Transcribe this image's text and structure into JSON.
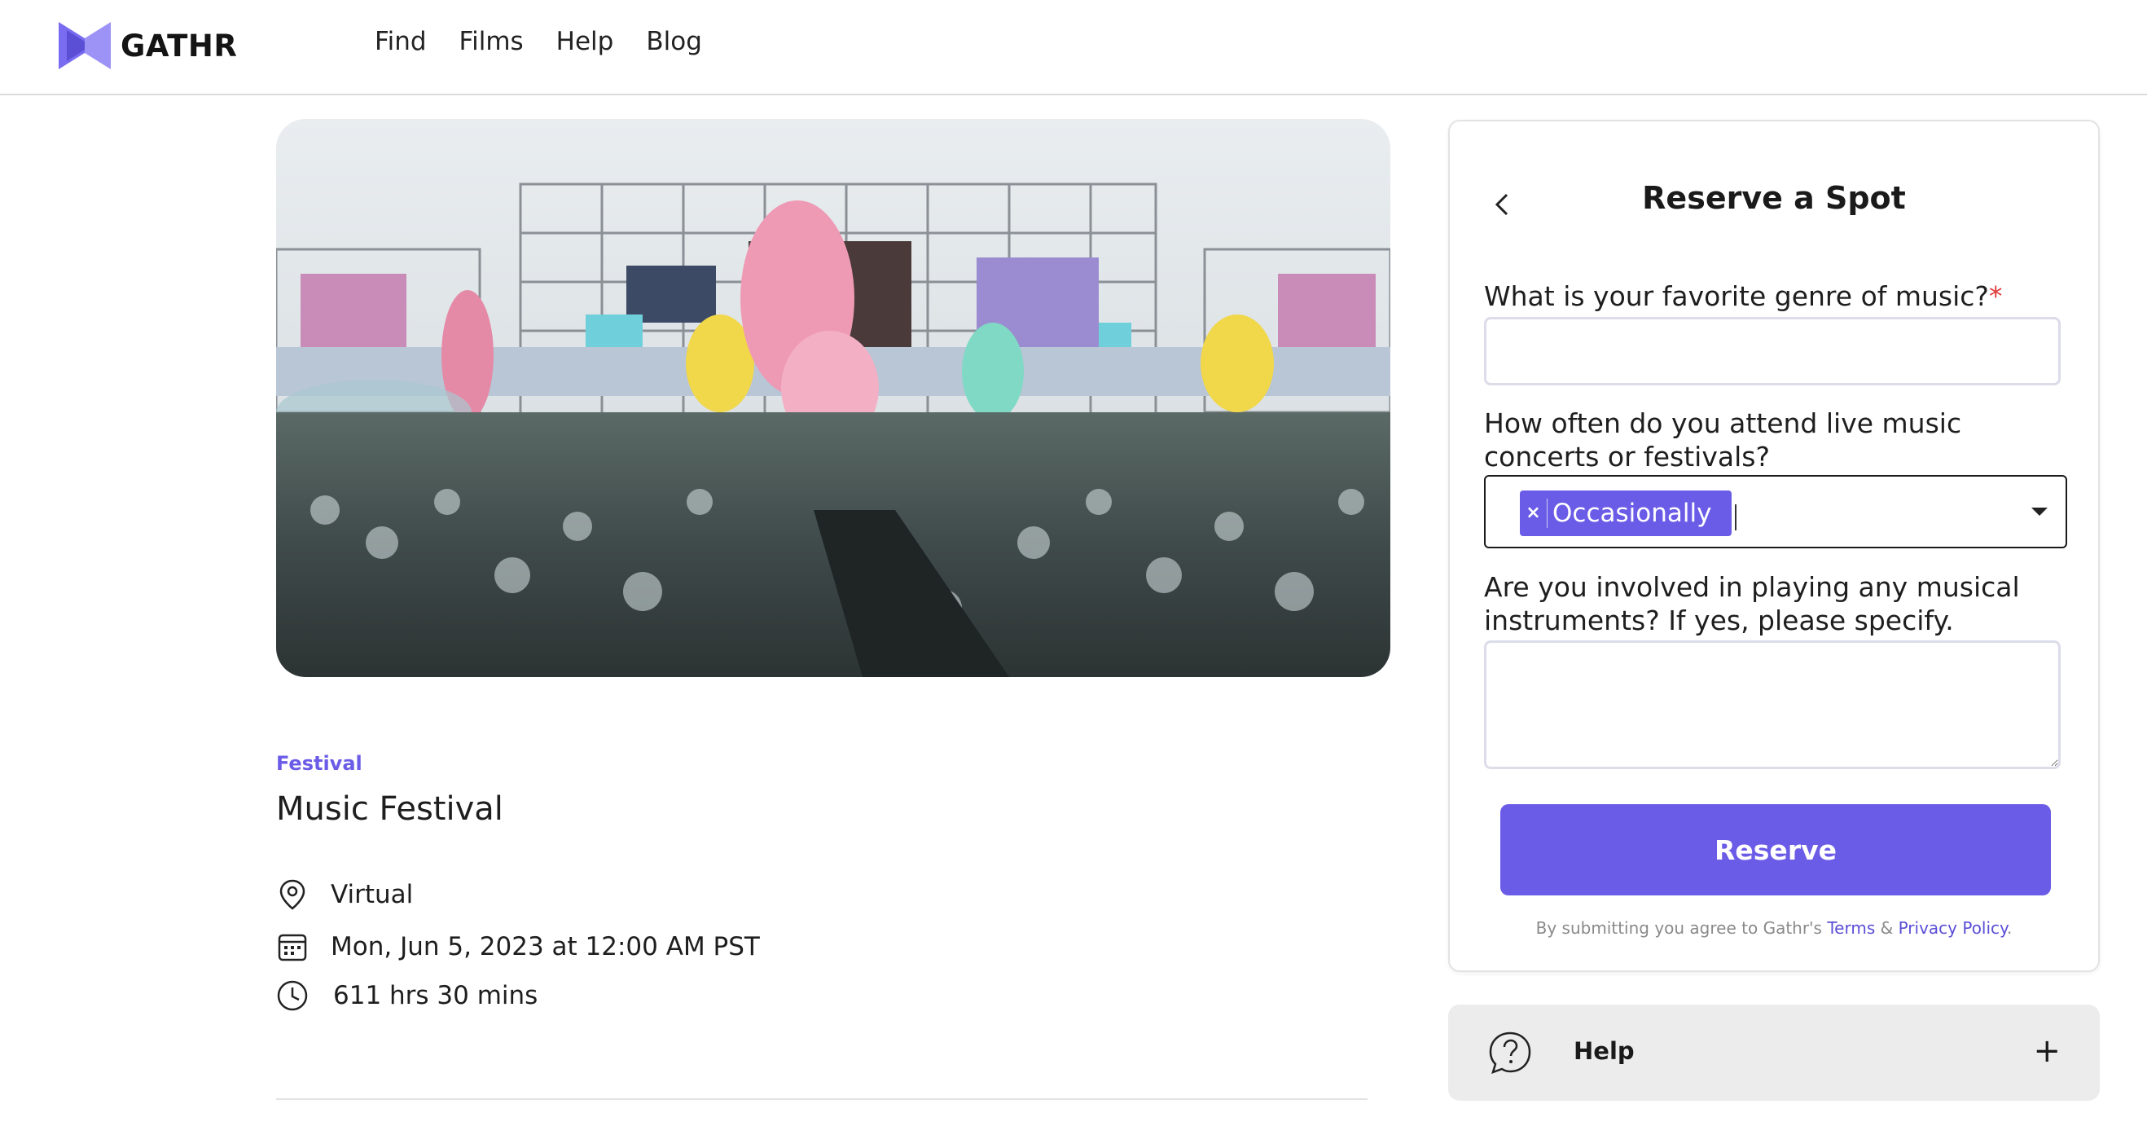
{
  "header": {
    "brand": "GATHR",
    "nav": [
      "Find",
      "Films",
      "Help",
      "Blog"
    ]
  },
  "event": {
    "category": "Festival",
    "title": "Music Festival",
    "location": "Virtual",
    "datetime": "Mon, Jun 5, 2023 at 12:00 AM PST",
    "duration": "611 hrs 30 mins"
  },
  "reserve": {
    "title": "Reserve a Spot",
    "q1": "What is your favorite genre of music?",
    "q1_required": "*",
    "q1_value": "",
    "q2": "How often do you attend live music concerts or festivals?",
    "q2_selected": "Occasionally",
    "q2_remove": "×",
    "q3": "Are you involved in playing any musical instruments? If yes, please specify.",
    "q3_value": "",
    "submit": "Reserve",
    "terms_prefix": "By submitting you agree to Gathr's",
    "terms_link": "Terms",
    "terms_amp": "&",
    "privacy_link": "Privacy Policy",
    "terms_suffix": "."
  },
  "help": {
    "label": "Help",
    "toggle": "+"
  },
  "colors": {
    "accent": "#6b5ce7",
    "required": "#e03b3b"
  },
  "icons": {
    "location": "map-pin-icon",
    "date": "calendar-icon",
    "duration": "clock-icon",
    "back": "chevron-left-icon",
    "help": "question-bubble-icon"
  }
}
